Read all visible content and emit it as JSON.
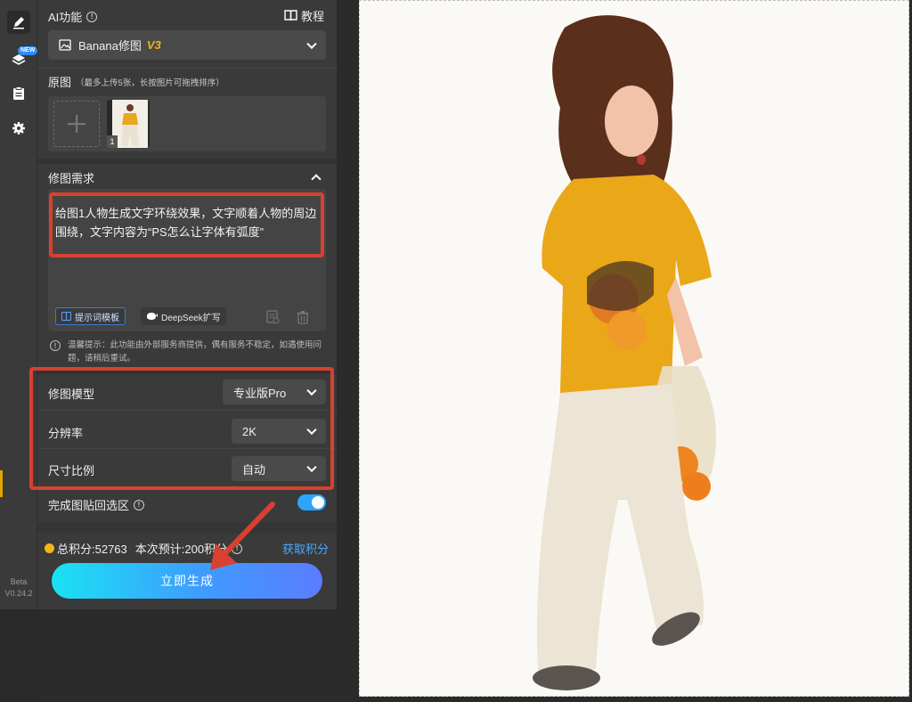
{
  "rail": {
    "new_badge": "NEW",
    "version_label": "Beta",
    "version_number": "V0.24.2"
  },
  "header": {
    "title": "AI功能",
    "tutorial_label": "教程"
  },
  "model_select": {
    "name": "Banana修图",
    "version_tag": "V3"
  },
  "original": {
    "title": "原图",
    "hint": "（最多上传5张，长按图片可拖拽排序）",
    "thumbnail_index": "1"
  },
  "prompt": {
    "title": "修图需求",
    "text": "给图1人物生成文字环绕效果，文字顺着人物的周边围绕，文字内容为“PS怎么让字体有弧度”",
    "template_chip": "提示词模板",
    "deepseek_chip": "DeepSeek扩写"
  },
  "notice": {
    "text": "温馨提示：此功能由外部服务商提供，偶有服务不稳定，如遇使用问题，请稍后重试。"
  },
  "settings": {
    "model_label": "修图模型",
    "model_value": "专业版Pro",
    "resolution_label": "分辨率",
    "resolution_value": "2K",
    "ratio_label": "尺寸比例",
    "ratio_value": "自动",
    "paste_back_label": "完成图贴回选区",
    "paste_back_on": true
  },
  "footer": {
    "credits_text": "总积分:52763",
    "estimate_text": "本次预计:200积分",
    "get_credits": "获取积分",
    "generate_label": "立即生成"
  },
  "colors": {
    "accent_blue": "#2fa4ff",
    "highlight_red": "#d94030",
    "version_gold": "#f2b418"
  }
}
